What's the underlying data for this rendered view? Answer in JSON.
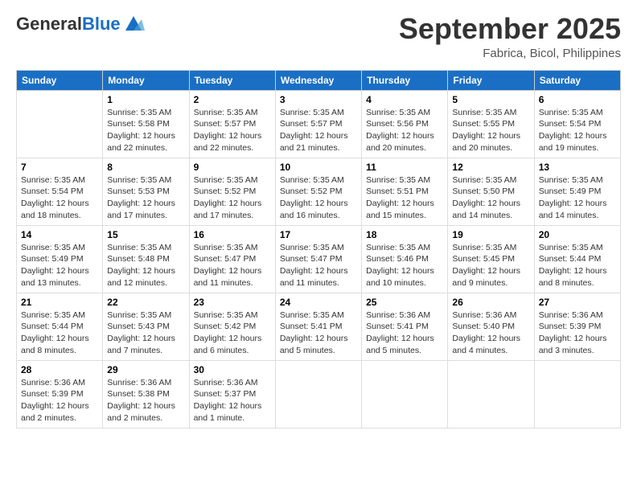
{
  "logo": {
    "general": "General",
    "blue": "Blue"
  },
  "title": "September 2025",
  "subtitle": "Fabrica, Bicol, Philippines",
  "days_of_week": [
    "Sunday",
    "Monday",
    "Tuesday",
    "Wednesday",
    "Thursday",
    "Friday",
    "Saturday"
  ],
  "weeks": [
    [
      {
        "num": "",
        "info": ""
      },
      {
        "num": "1",
        "info": "Sunrise: 5:35 AM\nSunset: 5:58 PM\nDaylight: 12 hours\nand 22 minutes."
      },
      {
        "num": "2",
        "info": "Sunrise: 5:35 AM\nSunset: 5:57 PM\nDaylight: 12 hours\nand 22 minutes."
      },
      {
        "num": "3",
        "info": "Sunrise: 5:35 AM\nSunset: 5:57 PM\nDaylight: 12 hours\nand 21 minutes."
      },
      {
        "num": "4",
        "info": "Sunrise: 5:35 AM\nSunset: 5:56 PM\nDaylight: 12 hours\nand 20 minutes."
      },
      {
        "num": "5",
        "info": "Sunrise: 5:35 AM\nSunset: 5:55 PM\nDaylight: 12 hours\nand 20 minutes."
      },
      {
        "num": "6",
        "info": "Sunrise: 5:35 AM\nSunset: 5:54 PM\nDaylight: 12 hours\nand 19 minutes."
      }
    ],
    [
      {
        "num": "7",
        "info": "Sunrise: 5:35 AM\nSunset: 5:54 PM\nDaylight: 12 hours\nand 18 minutes."
      },
      {
        "num": "8",
        "info": "Sunrise: 5:35 AM\nSunset: 5:53 PM\nDaylight: 12 hours\nand 17 minutes."
      },
      {
        "num": "9",
        "info": "Sunrise: 5:35 AM\nSunset: 5:52 PM\nDaylight: 12 hours\nand 17 minutes."
      },
      {
        "num": "10",
        "info": "Sunrise: 5:35 AM\nSunset: 5:52 PM\nDaylight: 12 hours\nand 16 minutes."
      },
      {
        "num": "11",
        "info": "Sunrise: 5:35 AM\nSunset: 5:51 PM\nDaylight: 12 hours\nand 15 minutes."
      },
      {
        "num": "12",
        "info": "Sunrise: 5:35 AM\nSunset: 5:50 PM\nDaylight: 12 hours\nand 14 minutes."
      },
      {
        "num": "13",
        "info": "Sunrise: 5:35 AM\nSunset: 5:49 PM\nDaylight: 12 hours\nand 14 minutes."
      }
    ],
    [
      {
        "num": "14",
        "info": "Sunrise: 5:35 AM\nSunset: 5:49 PM\nDaylight: 12 hours\nand 13 minutes."
      },
      {
        "num": "15",
        "info": "Sunrise: 5:35 AM\nSunset: 5:48 PM\nDaylight: 12 hours\nand 12 minutes."
      },
      {
        "num": "16",
        "info": "Sunrise: 5:35 AM\nSunset: 5:47 PM\nDaylight: 12 hours\nand 11 minutes."
      },
      {
        "num": "17",
        "info": "Sunrise: 5:35 AM\nSunset: 5:47 PM\nDaylight: 12 hours\nand 11 minutes."
      },
      {
        "num": "18",
        "info": "Sunrise: 5:35 AM\nSunset: 5:46 PM\nDaylight: 12 hours\nand 10 minutes."
      },
      {
        "num": "19",
        "info": "Sunrise: 5:35 AM\nSunset: 5:45 PM\nDaylight: 12 hours\nand 9 minutes."
      },
      {
        "num": "20",
        "info": "Sunrise: 5:35 AM\nSunset: 5:44 PM\nDaylight: 12 hours\nand 8 minutes."
      }
    ],
    [
      {
        "num": "21",
        "info": "Sunrise: 5:35 AM\nSunset: 5:44 PM\nDaylight: 12 hours\nand 8 minutes."
      },
      {
        "num": "22",
        "info": "Sunrise: 5:35 AM\nSunset: 5:43 PM\nDaylight: 12 hours\nand 7 minutes."
      },
      {
        "num": "23",
        "info": "Sunrise: 5:35 AM\nSunset: 5:42 PM\nDaylight: 12 hours\nand 6 minutes."
      },
      {
        "num": "24",
        "info": "Sunrise: 5:35 AM\nSunset: 5:41 PM\nDaylight: 12 hours\nand 5 minutes."
      },
      {
        "num": "25",
        "info": "Sunrise: 5:36 AM\nSunset: 5:41 PM\nDaylight: 12 hours\nand 5 minutes."
      },
      {
        "num": "26",
        "info": "Sunrise: 5:36 AM\nSunset: 5:40 PM\nDaylight: 12 hours\nand 4 minutes."
      },
      {
        "num": "27",
        "info": "Sunrise: 5:36 AM\nSunset: 5:39 PM\nDaylight: 12 hours\nand 3 minutes."
      }
    ],
    [
      {
        "num": "28",
        "info": "Sunrise: 5:36 AM\nSunset: 5:39 PM\nDaylight: 12 hours\nand 2 minutes."
      },
      {
        "num": "29",
        "info": "Sunrise: 5:36 AM\nSunset: 5:38 PM\nDaylight: 12 hours\nand 2 minutes."
      },
      {
        "num": "30",
        "info": "Sunrise: 5:36 AM\nSunset: 5:37 PM\nDaylight: 12 hours\nand 1 minute."
      },
      {
        "num": "",
        "info": ""
      },
      {
        "num": "",
        "info": ""
      },
      {
        "num": "",
        "info": ""
      },
      {
        "num": "",
        "info": ""
      }
    ]
  ]
}
